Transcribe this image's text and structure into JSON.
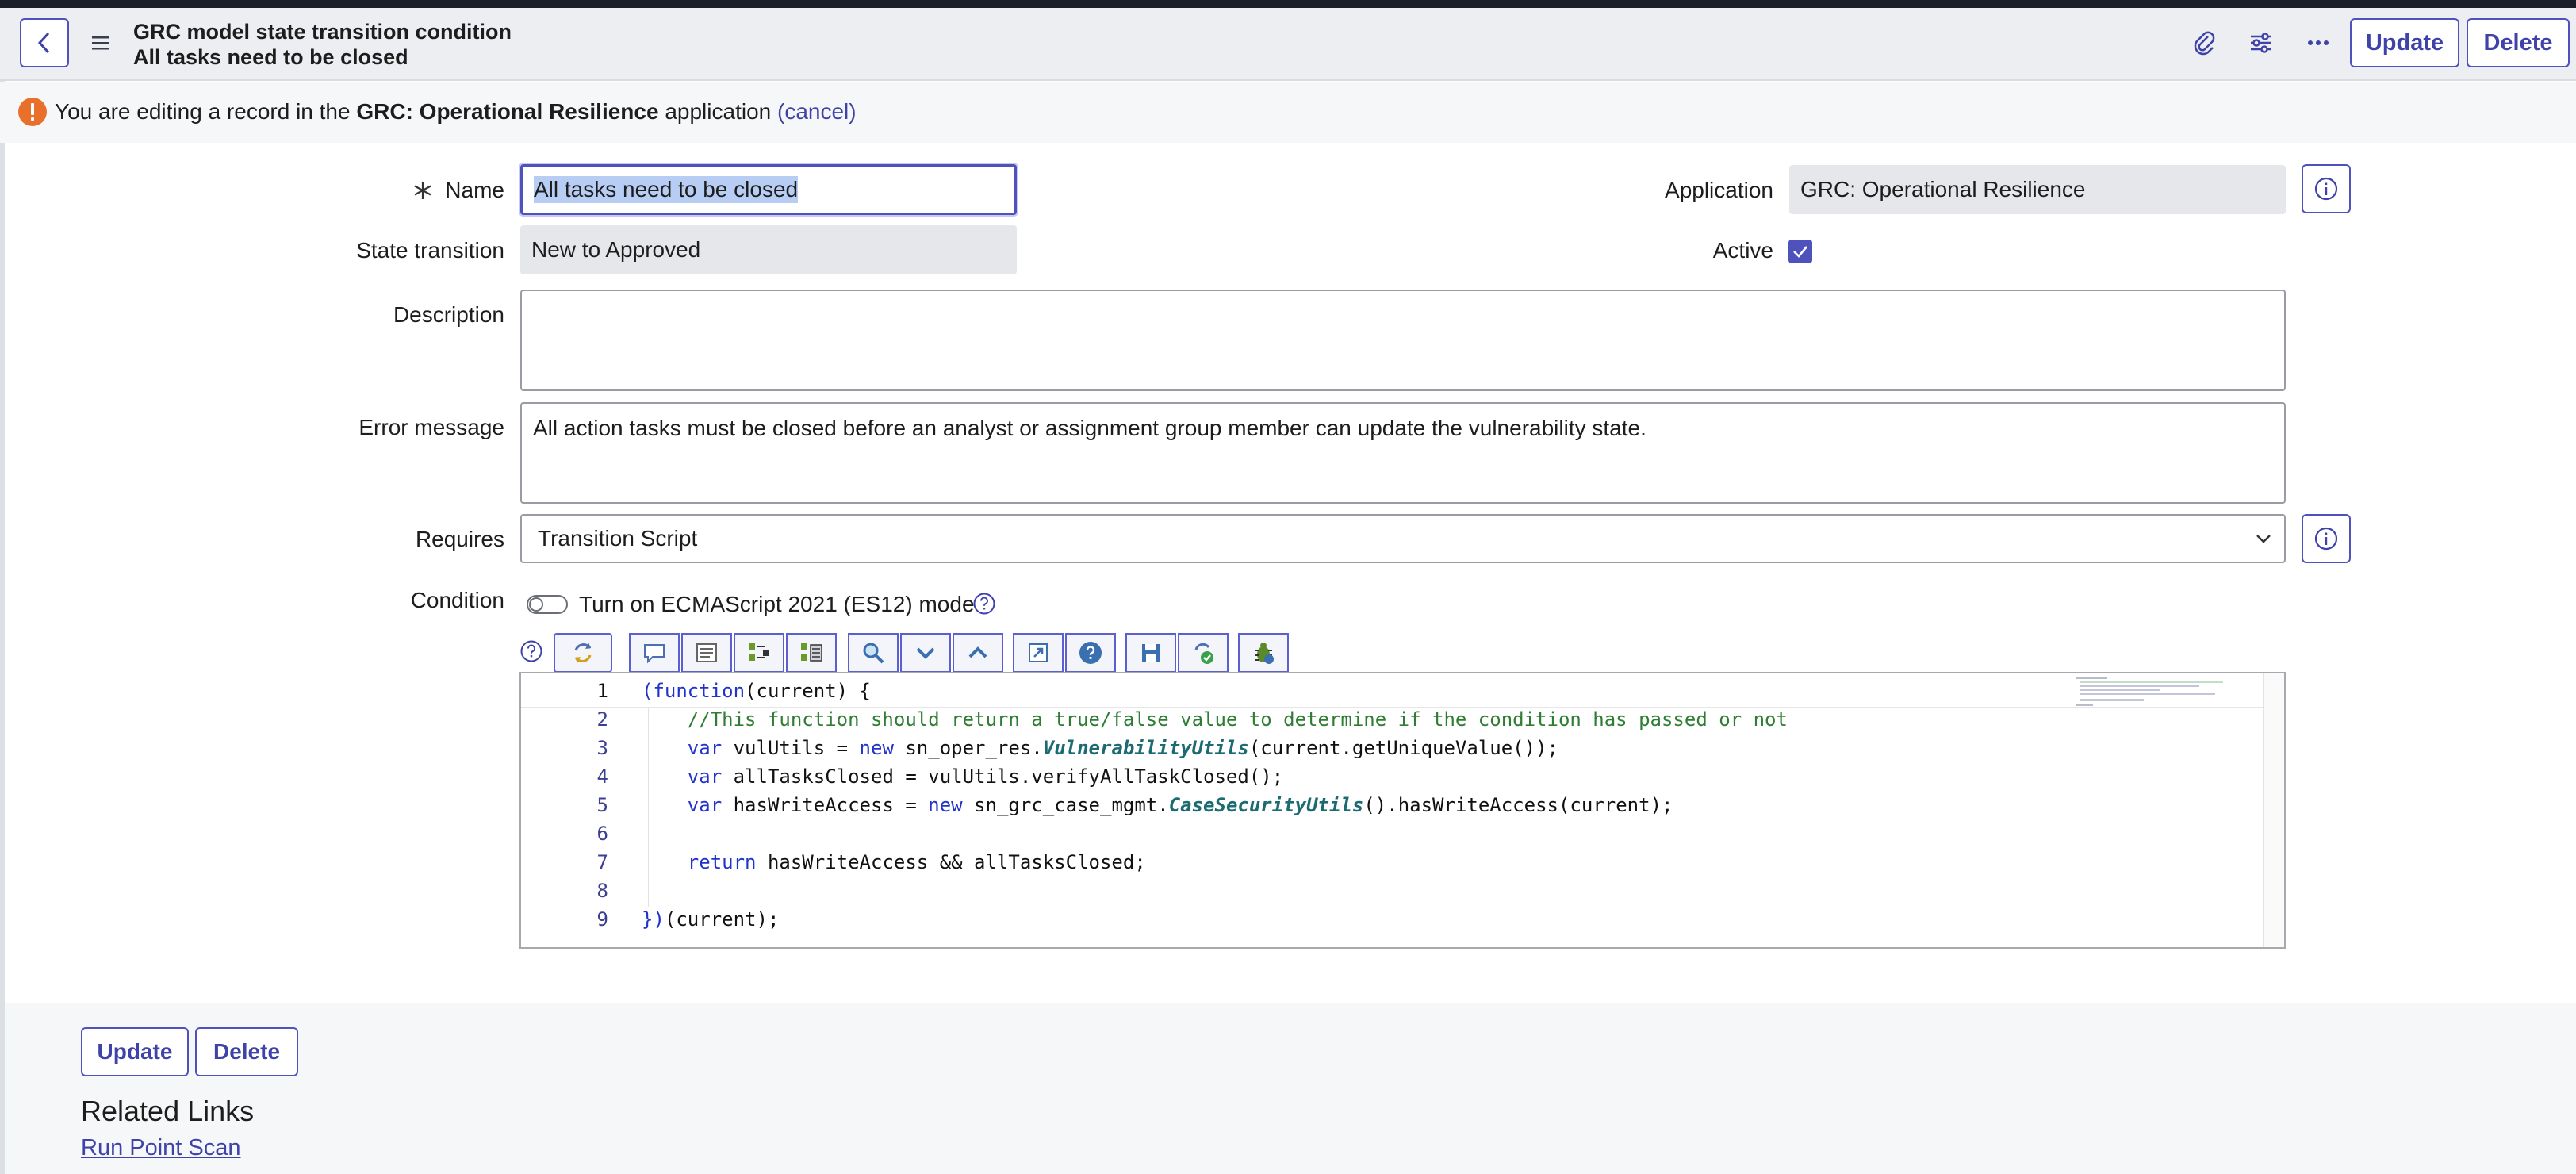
{
  "header": {
    "title_line1": "GRC model state transition condition",
    "title_line2": "All tasks need to be closed",
    "update_label": "Update",
    "delete_label": "Delete"
  },
  "notice": {
    "prefix": "You are editing a record in the ",
    "app_name": "GRC: Operational Resilience",
    "suffix": " application ",
    "cancel_link": "(cancel)"
  },
  "form": {
    "name_label": "Name",
    "name_value": "All tasks need to be closed",
    "state_transition_label": "State transition",
    "state_transition_value": "New to Approved",
    "application_label": "Application",
    "application_value": "GRC: Operational Resilience",
    "active_label": "Active",
    "active_checked": true,
    "description_label": "Description",
    "description_value": "",
    "error_message_label": "Error message",
    "error_message_value": "All action tasks must be closed before an analyst or assignment group member can update the vulnerability state.",
    "requires_label": "Requires",
    "requires_value": "Transition Script",
    "condition_label": "Condition",
    "ecma_toggle_label": "Turn on ECMAScript 2021 (ES12) mode"
  },
  "code": {
    "line_numbers": [
      "1",
      "2",
      "3",
      "4",
      "5",
      "6",
      "7",
      "8",
      "9"
    ]
  },
  "bottom": {
    "update_label": "Update",
    "delete_label": "Delete",
    "related_links_title": "Related Links",
    "run_point_scan": "Run Point Scan"
  },
  "colors": {
    "accent": "#4f52bd",
    "warning": "#e8702a",
    "header_bg": "#eceef1"
  }
}
